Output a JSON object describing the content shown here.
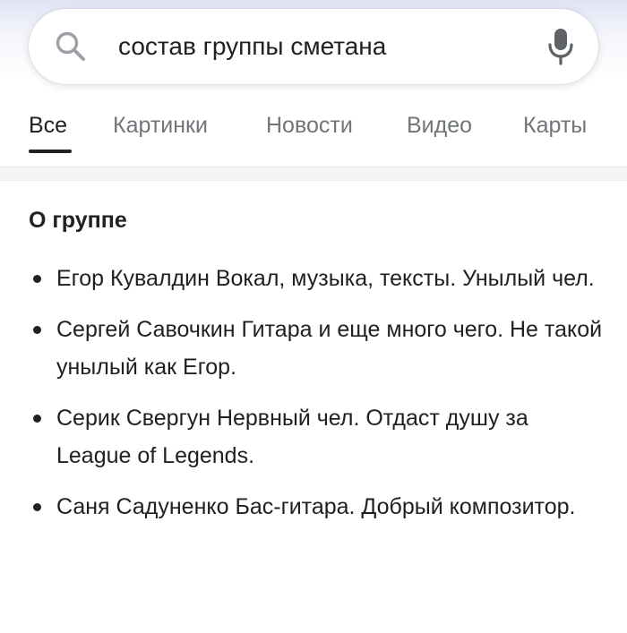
{
  "search": {
    "query": "состав группы сметана",
    "search_icon": "search-icon",
    "mic_icon": "microphone-icon"
  },
  "tabs": [
    {
      "label": "Все",
      "active": true
    },
    {
      "label": "Картинки",
      "active": false
    },
    {
      "label": "Новости",
      "active": false
    },
    {
      "label": "Видео",
      "active": false
    },
    {
      "label": "Карты",
      "active": false
    }
  ],
  "about": {
    "title": "О группе",
    "members": [
      {
        "text": "Егор Кувалдин Вокал, музыка, тексты. Унылый чел."
      },
      {
        "text": "Сергей Савочкин Гитара и еще много чего. Не такой унылый как Егор."
      },
      {
        "text": "Серик Свергун Нервный чел. Отдаст душу за League of Legends."
      },
      {
        "text": "Саня Садуненко Бас-гитара. Добрый композитор."
      }
    ]
  },
  "colors": {
    "text_primary": "#202124",
    "text_secondary": "#70757a",
    "search_icon": "#9aa0a6",
    "mic_icon": "#5f6368"
  }
}
